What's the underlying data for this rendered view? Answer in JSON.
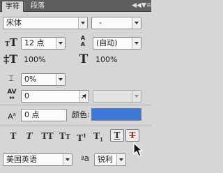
{
  "tabs": {
    "character": "字符",
    "paragraph": "段落",
    "collapse": "◀◀",
    "menu": "▼≡"
  },
  "font": {
    "family": "宋体",
    "style": "-"
  },
  "size": {
    "value": "12 点",
    "leading": "(自动)"
  },
  "scale": {
    "vertical": "100%",
    "horizontal": "100%"
  },
  "spacing": {
    "tsume": "0%",
    "tracking": "0",
    "kerning": ""
  },
  "baseline": {
    "value": "0 点"
  },
  "color": {
    "label": "颜色:",
    "swatch": "#3c78d8"
  },
  "styles": [
    "T",
    "T",
    "TT",
    "Tт",
    "T¹",
    "T,",
    "T",
    "T"
  ],
  "language": {
    "value": "美国英语"
  },
  "antialias": {
    "prefix": "a a",
    "value": "锐利"
  }
}
